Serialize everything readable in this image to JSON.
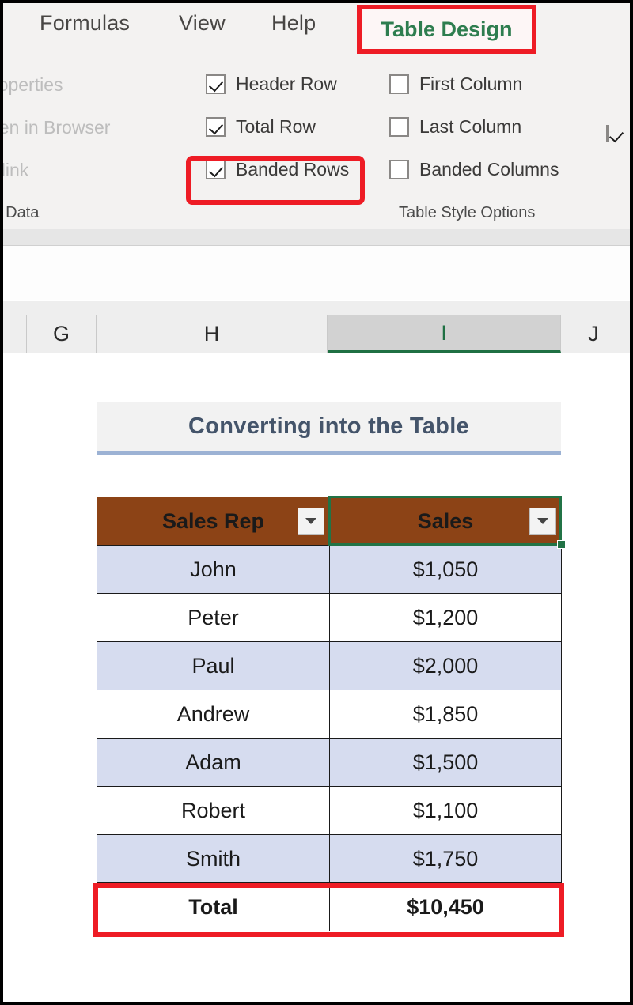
{
  "app": {
    "name": "Microsoft Excel",
    "accent_green": "#217346",
    "highlight_red": "#ee1c25",
    "table_header_brown": "#8c4316",
    "band_blue": "#d6dcef",
    "title_blue": "#44546a"
  },
  "ribbon": {
    "tabs": [
      {
        "label": "Formulas",
        "active": false
      },
      {
        "label": "View",
        "active": false
      },
      {
        "label": "Help",
        "active": false
      },
      {
        "label": "Table Design",
        "active": true,
        "highlighted": true
      }
    ],
    "external_table_data": {
      "group_label": "le Data",
      "group_label_full": "External Table Data",
      "commands": [
        {
          "label": "roperties",
          "full_label": "Properties",
          "enabled": false
        },
        {
          "label": "pen in Browser",
          "full_label": "Open in Browser",
          "enabled": false
        },
        {
          "label": "nlink",
          "full_label": "Unlink",
          "enabled": false
        }
      ]
    },
    "table_style_options": {
      "group_label": "Table Style Options",
      "checkboxes": [
        {
          "label": "Header Row",
          "checked": true,
          "highlighted": false
        },
        {
          "label": "Total Row",
          "checked": true,
          "highlighted": true
        },
        {
          "label": "Banded Rows",
          "checked": true,
          "highlighted": false
        },
        {
          "label": "First Column",
          "checked": false,
          "highlighted": false
        },
        {
          "label": "Last Column",
          "checked": false,
          "highlighted": false
        },
        {
          "label": "Banded Columns",
          "checked": false,
          "highlighted": false
        }
      ],
      "filter_button": {
        "label": "",
        "checked": true
      }
    }
  },
  "grid": {
    "columns": [
      {
        "label": "G",
        "selected": false
      },
      {
        "label": "H",
        "selected": false
      },
      {
        "label": "I",
        "selected": true
      },
      {
        "label": "J",
        "selected": false
      }
    ]
  },
  "sheet": {
    "title": "Converting into the Table",
    "table": {
      "headers": [
        "Sales Rep",
        "Sales"
      ],
      "rows": [
        {
          "rep": "John",
          "sales": "$1,050"
        },
        {
          "rep": "Peter",
          "sales": "$1,200"
        },
        {
          "rep": "Paul",
          "sales": "$2,000"
        },
        {
          "rep": "Andrew",
          "sales": "$1,850"
        },
        {
          "rep": "Adam",
          "sales": "$1,500"
        },
        {
          "rep": "Robert",
          "sales": "$1,100"
        },
        {
          "rep": "Smith",
          "sales": "$1,750"
        }
      ],
      "total": {
        "label": "Total",
        "value": "$10,450"
      },
      "selected_cell": "Sales"
    }
  }
}
